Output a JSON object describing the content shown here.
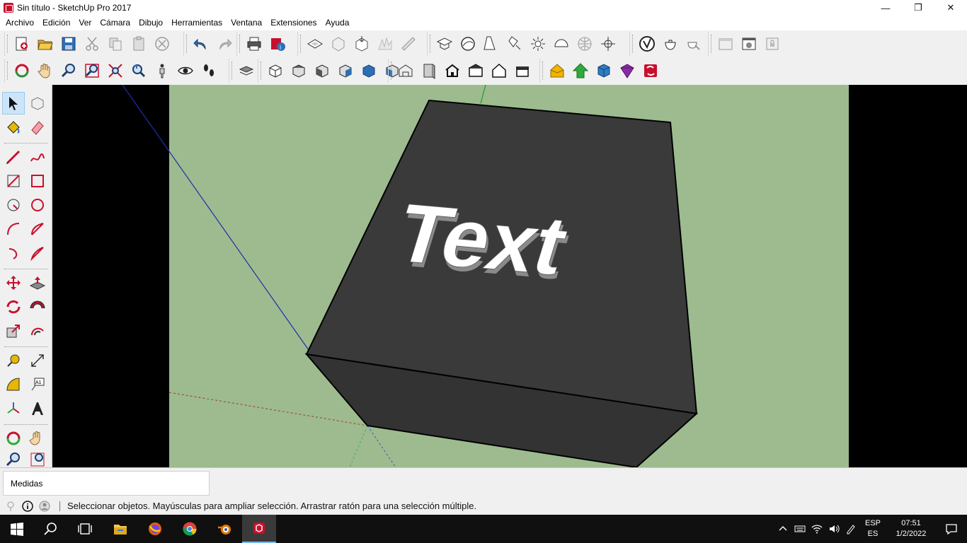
{
  "window": {
    "title": "Sin título - SketchUp Pro 2017",
    "controls": {
      "minimize": "—",
      "maximize": "❐",
      "close": "✕"
    }
  },
  "menubar": [
    "Archivo",
    "Edición",
    "Ver",
    "Cámara",
    "Dibujo",
    "Herramientas",
    "Ventana",
    "Extensiones",
    "Ayuda"
  ],
  "viewport": {
    "background_sky": "#000000",
    "ground_color": "#9dbb8f",
    "box_color": "#3a3a3a",
    "model_text": "Text"
  },
  "measurements": {
    "label": "Medidas",
    "value": ""
  },
  "status": {
    "message": "Seleccionar objetos. Mayúsculas para ampliar selección. Arrastrar ratón para una selección múltiple."
  },
  "taskbar": {
    "lang_top": "ESP",
    "lang_bottom": "ES",
    "time": "07:51",
    "date": "1/2/2022"
  },
  "colors": {
    "accent_blue": "#1e6fd0",
    "sketchup_red": "#c8102e"
  }
}
